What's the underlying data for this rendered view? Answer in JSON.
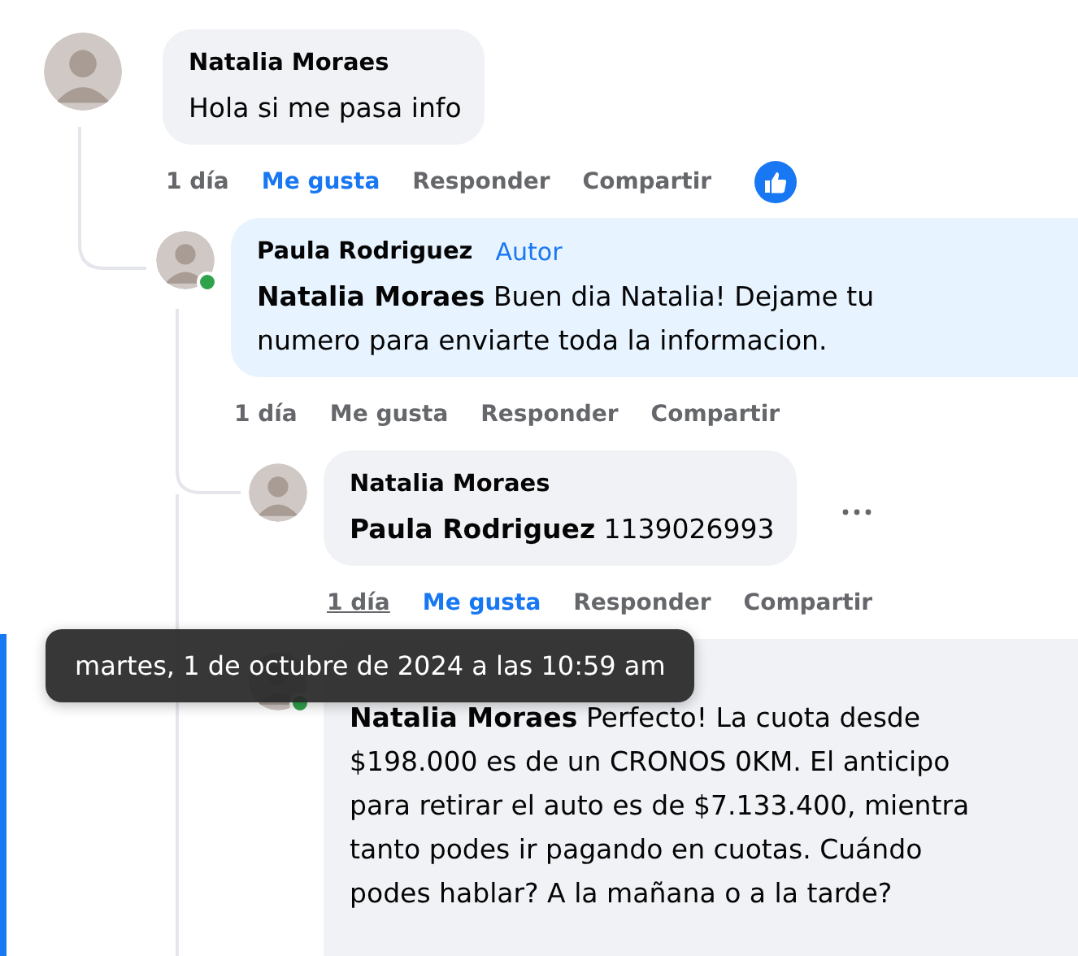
{
  "comments": [
    {
      "author": "Natalia Moraes",
      "online": false,
      "text": "Hola si me pasa info",
      "time": "1 día",
      "time_underlined": false,
      "like": {
        "label": "Me gusta",
        "selected": true
      },
      "reply": "Responder",
      "share": "Compartir",
      "reacted": true,
      "more_menu": false,
      "children": [
        {
          "author": "Paula Rodriguez",
          "online": true,
          "author_badge": "Autor",
          "text": "**Natalia Moraes** Buen dia Natalia! Dejame tu\nnumero para enviarte toda la informacion.",
          "time": "1 día",
          "time_underlined": false,
          "like": {
            "label": "Me gusta",
            "selected": false
          },
          "reply": "Responder",
          "share": "Compartir",
          "reacted": false,
          "more_menu": false,
          "children": [
            {
              "author": "Natalia Moraes",
              "online": false,
              "text": "**Paula Rodriguez** 1139026993",
              "time": "1 día",
              "time_underlined": true,
              "like": {
                "label": "Me gusta",
                "selected": true
              },
              "reply": "Responder",
              "share": "Compartir",
              "reacted": false,
              "more_menu": true
            },
            {
              "online": true,
              "text": "**Natalia Moraes** Perfecto! La cuota desde\n$198.000 es de un CRONOS 0KM. El anticipo\npara retirar el auto es de $7.133.400, mientra\ntanto podes ir pagando en cuotas. Cuándo\npodes hablar? A la mañana o a la tarde?",
              "more_menu": false
            }
          ]
        }
      ]
    }
  ],
  "tooltip": {
    "text": "martes, 1 de octubre de 2024 a las 10:59 am"
  }
}
